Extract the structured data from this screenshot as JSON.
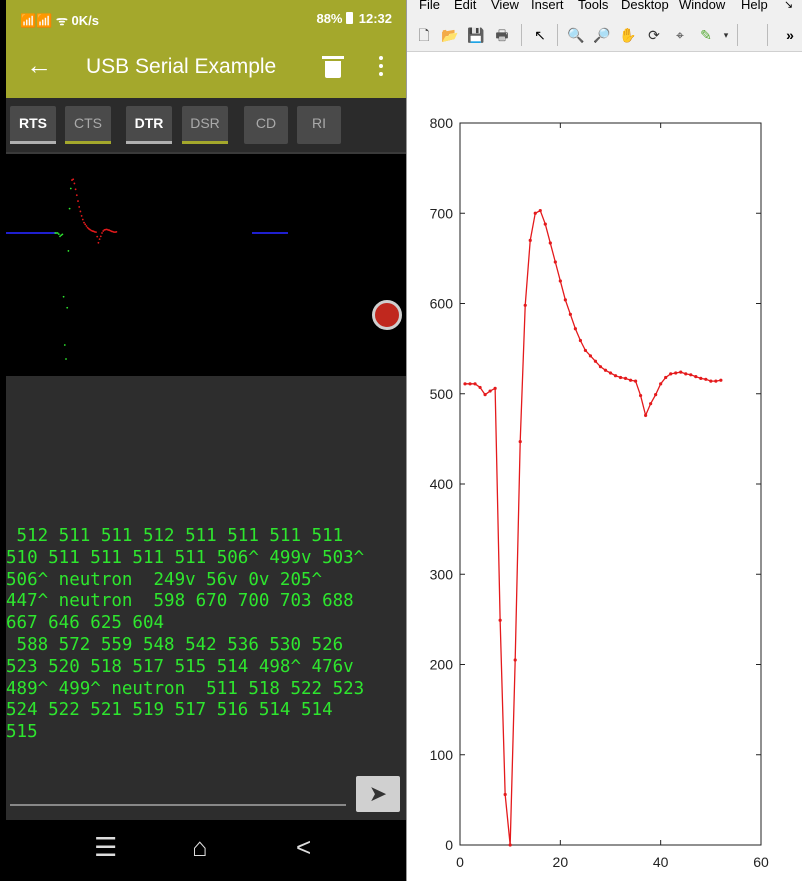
{
  "status_bar": {
    "left": "📶📶 ᯤ 0K/s",
    "battery": "88%",
    "time": "12:32"
  },
  "app_bar": {
    "title": "USB Serial Example"
  },
  "toggles": [
    {
      "label": "RTS",
      "state": "on",
      "underline": "#b0b0b0"
    },
    {
      "label": "CTS",
      "state": "off",
      "underline": "#a4a82c"
    },
    {
      "label": "DTR",
      "state": "on",
      "underline": "#b0b0b0"
    },
    {
      "label": "DSR",
      "state": "off",
      "underline": "#a4a82c"
    },
    {
      "label": "CD",
      "state": "off",
      "underline": ""
    },
    {
      "label": "RI",
      "state": "off",
      "underline": ""
    }
  ],
  "terminal_lines": [
    " 512 511 511 512 511 511 511 511",
    "510 511 511 511 511 506^ 499v 503^",
    "506^ neutron  249v 56v 0v 205^",
    "447^ neutron  598 670 700 703 688",
    "667 646 625 604",
    " 588 572 559 548 542 536 530 526",
    "523 520 518 517 515 514 498^ 476v",
    "489^ 499^ neutron  511 518 522 523",
    "524 522 521 519 517 516 514 514",
    "515"
  ],
  "input": {
    "value": "",
    "send_icon": "send-icon"
  },
  "nav_icons": {
    "recent": "☰",
    "home": "⌂",
    "back": "<"
  },
  "figure_menu": [
    "File",
    "Edit",
    "View",
    "Insert",
    "Tools",
    "Desktop",
    "Window",
    "Help"
  ],
  "colors": {
    "accent": "#a4a82c",
    "terminal_text": "#2ee62e",
    "plot_line": "#e41a1c",
    "baseline": "#1f1fcf"
  },
  "chart_data": {
    "type": "line",
    "title": "",
    "xlabel": "",
    "ylabel": "",
    "xlim": [
      0,
      60
    ],
    "ylim": [
      0,
      800
    ],
    "xticks": [
      0,
      20,
      40,
      60
    ],
    "yticks": [
      0,
      100,
      200,
      300,
      400,
      500,
      600,
      700,
      800
    ],
    "grid": false,
    "series": [
      {
        "color": "#e41a1c",
        "x": [
          1,
          2,
          3,
          4,
          5,
          6,
          7,
          8,
          9,
          10,
          11,
          12,
          13,
          14,
          15,
          16,
          17,
          18,
          19,
          20,
          21,
          22,
          23,
          24,
          25,
          26,
          27,
          28,
          29,
          30,
          31,
          32,
          33,
          34,
          35,
          36,
          37,
          38,
          39,
          40,
          41,
          42,
          43,
          44,
          45,
          46,
          47,
          48,
          49,
          50,
          51,
          52
        ],
        "y": [
          511,
          511,
          511,
          507,
          499,
          503,
          506,
          249,
          56,
          0,
          205,
          447,
          598,
          670,
          700,
          703,
          688,
          667,
          646,
          625,
          604,
          588,
          572,
          559,
          548,
          542,
          536,
          530,
          526,
          523,
          520,
          518,
          517,
          515,
          514,
          498,
          476,
          489,
          499,
          511,
          518,
          522,
          523,
          524,
          522,
          521,
          519,
          517,
          516,
          514,
          514,
          515
        ]
      }
    ]
  }
}
